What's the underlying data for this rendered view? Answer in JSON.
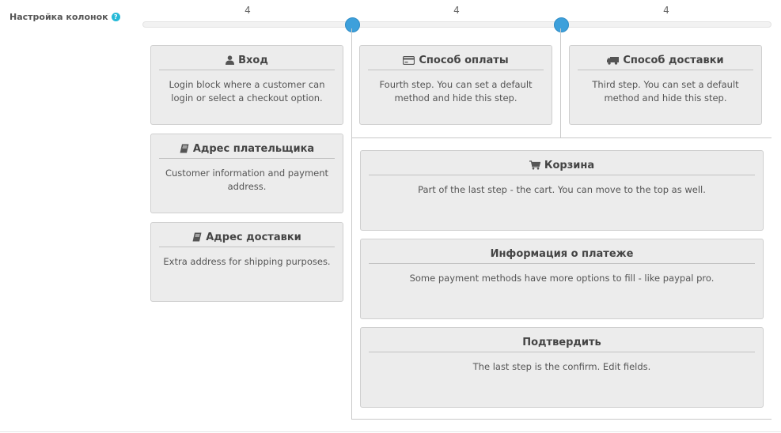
{
  "setting": {
    "label": "Настройка колонок",
    "help": "?"
  },
  "columns": [
    "4",
    "4",
    "4"
  ],
  "panels": {
    "login": {
      "title": "Вход",
      "desc": "Login block where a customer can login or select a checkout option.",
      "icon": "user-icon"
    },
    "payment": {
      "title": "Способ оплаты",
      "desc": "Fourth step. You can set a default method and hide this step.",
      "icon": "credit-card-icon"
    },
    "shipping": {
      "title": "Способ доставки",
      "desc": "Third step. You can set a default method and hide this step.",
      "icon": "truck-icon"
    },
    "payer": {
      "title": "Адрес плательщика",
      "desc": "Customer information and payment address.",
      "icon": "book-icon"
    },
    "shipaddr": {
      "title": "Адрес доставки",
      "desc": "Extra address for shipping purposes.",
      "icon": "book-icon"
    },
    "cart": {
      "title": "Корзина",
      "desc": "Part of the last step - the cart. You can move to the top as well.",
      "icon": "cart-icon"
    },
    "payinfo": {
      "title": "Информация о платеже",
      "desc": "Some payment methods have more options to fill - like paypal pro."
    },
    "confirm": {
      "title": "Подтвердить",
      "desc": "The last step is the confirm. Edit fields."
    }
  }
}
